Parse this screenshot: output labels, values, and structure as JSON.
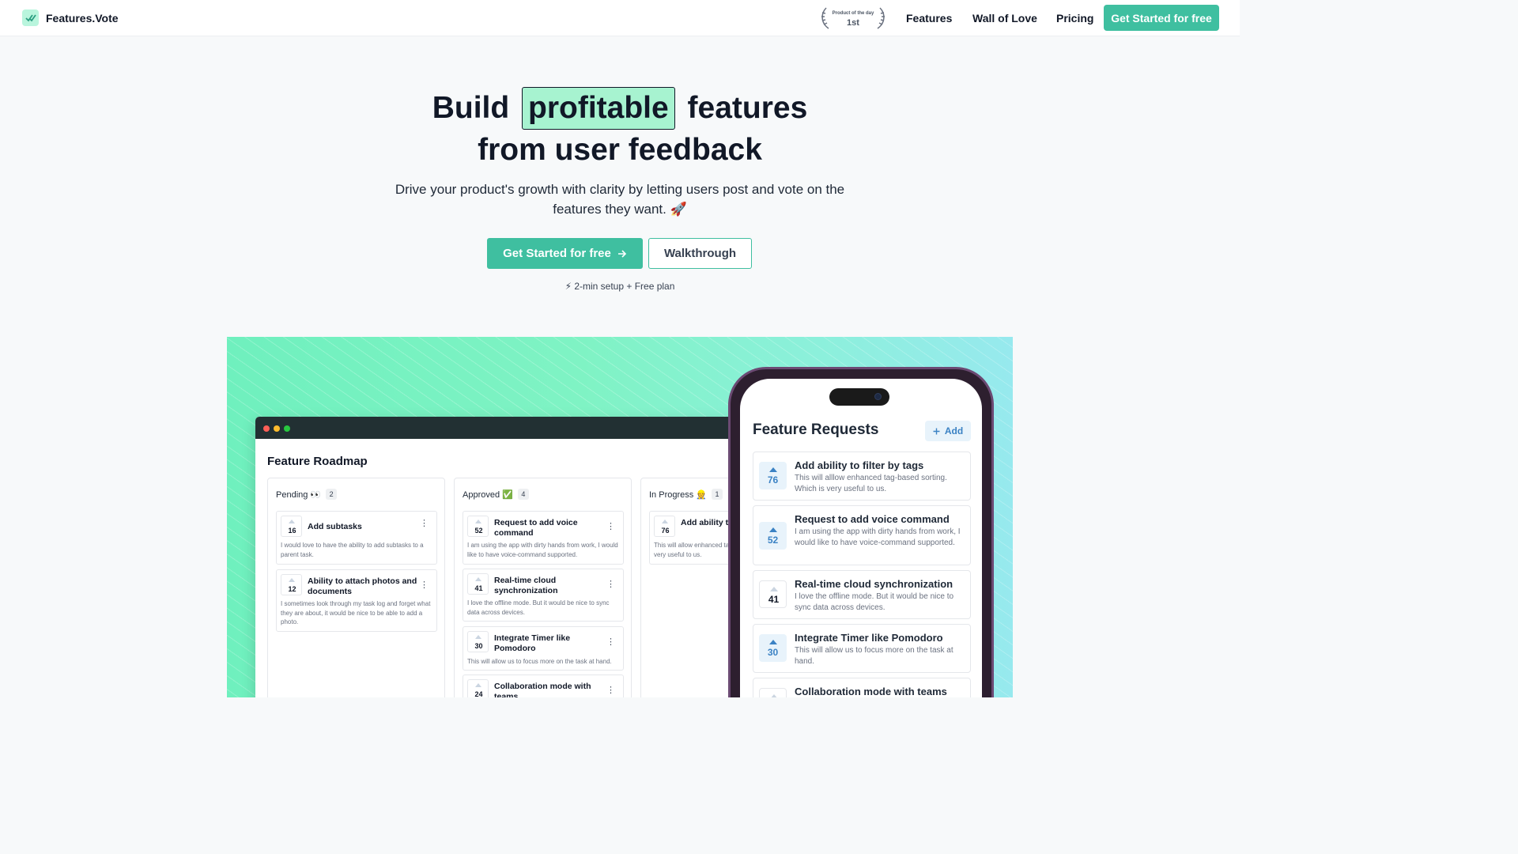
{
  "nav": {
    "brand": "Features.Vote",
    "badge_small": "Product of the day",
    "badge_big": "1st",
    "links": [
      "Features",
      "Wall of Love",
      "Pricing"
    ],
    "cta": "Get Started for free"
  },
  "hero": {
    "title_before": "Build",
    "title_highlight": "profitable",
    "title_after": "features",
    "title_line2": "from user feedback",
    "subtitle": "Drive your product's growth with clarity by letting users post and vote on the features they want. 🚀",
    "primary_button": "Get Started for free",
    "secondary_button": "Walkthrough",
    "setup_note": "⚡ 2-min setup + Free plan"
  },
  "roadmap": {
    "title": "Feature Roadmap",
    "columns": [
      {
        "name": "Pending 👀",
        "count": "2",
        "cards": [
          {
            "votes": "16",
            "title": "Add subtasks",
            "desc": "I would love to have the ability to add subtasks to a parent task."
          },
          {
            "votes": "12",
            "title": "Ability to attach photos and documents",
            "desc": "I sometimes look through my task log and forget what they are about, it would be nice to be able to add a photo."
          }
        ]
      },
      {
        "name": "Approved ✅",
        "count": "4",
        "cards": [
          {
            "votes": "52",
            "title": "Request to add voice command",
            "desc": "I am using the app with dirty hands from work, I would like to have voice-command supported."
          },
          {
            "votes": "41",
            "title": "Real-time cloud synchronization",
            "desc": "I love the offline mode. But it would be nice to sync data across devices."
          },
          {
            "votes": "30",
            "title": "Integrate Timer like Pomodoro",
            "desc": "This will allow us to focus more on the task at hand."
          },
          {
            "votes": "24",
            "title": "Collaboration mode with teams",
            "desc": ""
          }
        ]
      },
      {
        "name": "In Progress 👷",
        "count": "1",
        "cards": [
          {
            "votes": "76",
            "title": "Add ability to filter by tags",
            "desc": "This will allow enhanced tag-based sorting. Which is very useful to us."
          }
        ]
      }
    ]
  },
  "phone": {
    "title": "Feature Requests",
    "add_label": "Add",
    "cards": [
      {
        "votes": "76",
        "upvoted": true,
        "title": "Add ability to filter by tags",
        "desc": "This will alllow enhanced tag-based sorting. Which is very useful to us."
      },
      {
        "votes": "52",
        "upvoted": true,
        "title": "Request to add voice command",
        "desc": "I am using the app with dirty hands from work, I would like to have voice-command supported."
      },
      {
        "votes": "41",
        "upvoted": false,
        "title": "Real-time cloud synchronization",
        "desc": "I love the offline mode. But it would be nice to sync data across devices."
      },
      {
        "votes": "30",
        "upvoted": true,
        "title": "Integrate Timer like Pomodoro",
        "desc": "This will allow us to focus more on the task at hand."
      },
      {
        "votes": "24",
        "upvoted": false,
        "title": "Collaboration mode with teams",
        "desc": ""
      }
    ]
  },
  "colors": {
    "accent": "#3fbfa0",
    "highlight": "#a7f3d0",
    "vote_blue": "#3b82c4",
    "window_bar": "#223033",
    "dot_red": "#ff5f57",
    "dot_yellow": "#febc2e",
    "dot_green": "#28c840"
  },
  "icons": {
    "brand": "double-check-icon",
    "arrow": "arrow-right-icon",
    "add": "plus-icon",
    "menu": "kebab-menu-icon",
    "upvote": "upvote-triangle-icon"
  }
}
